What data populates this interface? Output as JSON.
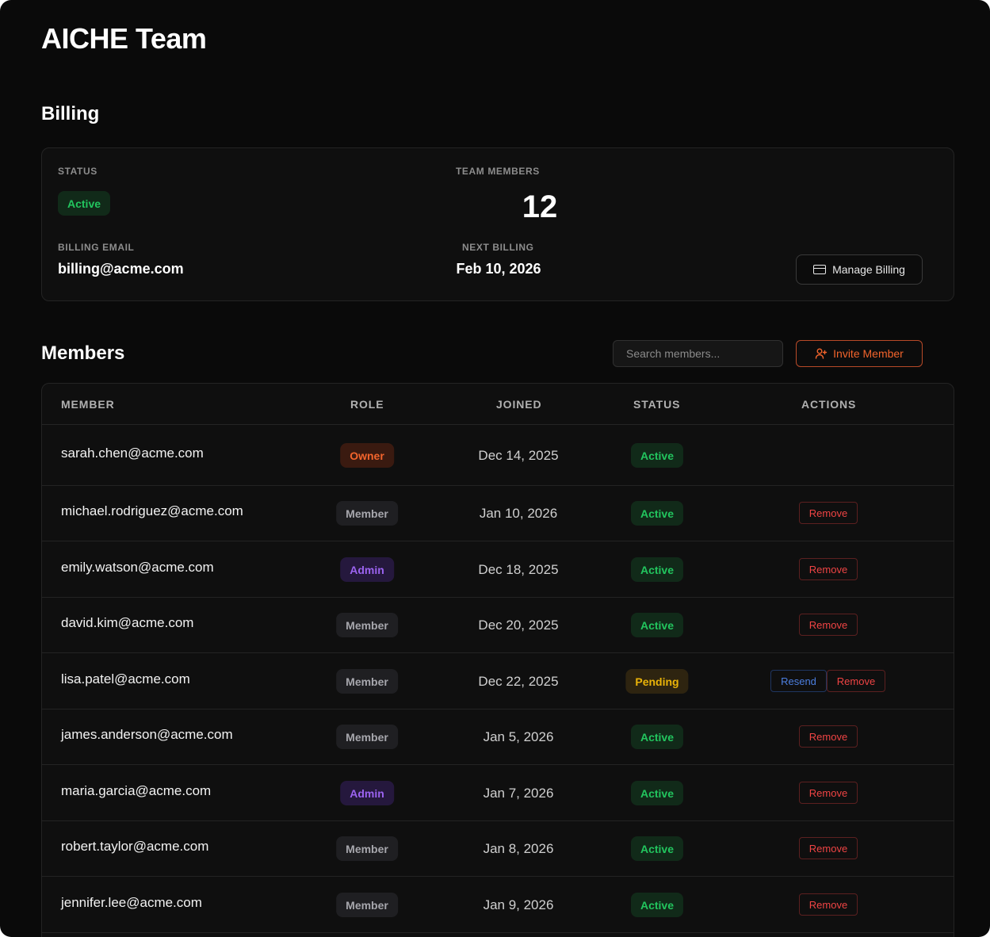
{
  "page": {
    "title": "AICHE Team"
  },
  "billing": {
    "section_title": "Billing",
    "status_label": "STATUS",
    "status_value": "Active",
    "team_members_label": "TEAM MEMBERS",
    "team_members_count": "12",
    "email_label": "BILLING EMAIL",
    "email_value": "billing@acme.com",
    "next_billing_label": "NEXT BILLING",
    "next_billing_value": "Feb 10, 2026",
    "manage_button": "Manage Billing"
  },
  "members": {
    "section_title": "Members",
    "search_placeholder": "Search members...",
    "invite_button": "Invite Member",
    "columns": {
      "member": "MEMBER",
      "role": "ROLE",
      "joined": "JOINED",
      "status": "STATUS",
      "actions": "ACTIONS"
    },
    "rows": [
      {
        "email": "sarah.chen@acme.com",
        "role": "Owner",
        "joined": "Dec 14, 2025",
        "status": "Active",
        "actions": []
      },
      {
        "email": "michael.rodriguez@acme.com",
        "role": "Member",
        "joined": "Jan 10, 2026",
        "status": "Active",
        "actions": [
          "Remove"
        ]
      },
      {
        "email": "emily.watson@acme.com",
        "role": "Admin",
        "joined": "Dec 18, 2025",
        "status": "Active",
        "actions": [
          "Remove"
        ]
      },
      {
        "email": "david.kim@acme.com",
        "role": "Member",
        "joined": "Dec 20, 2025",
        "status": "Active",
        "actions": [
          "Remove"
        ]
      },
      {
        "email": "lisa.patel@acme.com",
        "role": "Member",
        "joined": "Dec 22, 2025",
        "status": "Pending",
        "actions": [
          "Resend",
          "Remove"
        ]
      },
      {
        "email": "james.anderson@acme.com",
        "role": "Member",
        "joined": "Jan 5, 2026",
        "status": "Active",
        "actions": [
          "Remove"
        ]
      },
      {
        "email": "maria.garcia@acme.com",
        "role": "Admin",
        "joined": "Jan 7, 2026",
        "status": "Active",
        "actions": [
          "Remove"
        ]
      },
      {
        "email": "robert.taylor@acme.com",
        "role": "Member",
        "joined": "Jan 8, 2026",
        "status": "Active",
        "actions": [
          "Remove"
        ]
      },
      {
        "email": "jennifer.lee@acme.com",
        "role": "Member",
        "joined": "Jan 9, 2026",
        "status": "Active",
        "actions": [
          "Remove"
        ]
      }
    ]
  },
  "colors": {
    "background": "#0a0a0a",
    "accent": "#f2642c",
    "active": "#22c55e",
    "pending": "#eab308",
    "admin": "#9b63f0",
    "danger": "#ef4444",
    "link": "#4c7fe0"
  }
}
